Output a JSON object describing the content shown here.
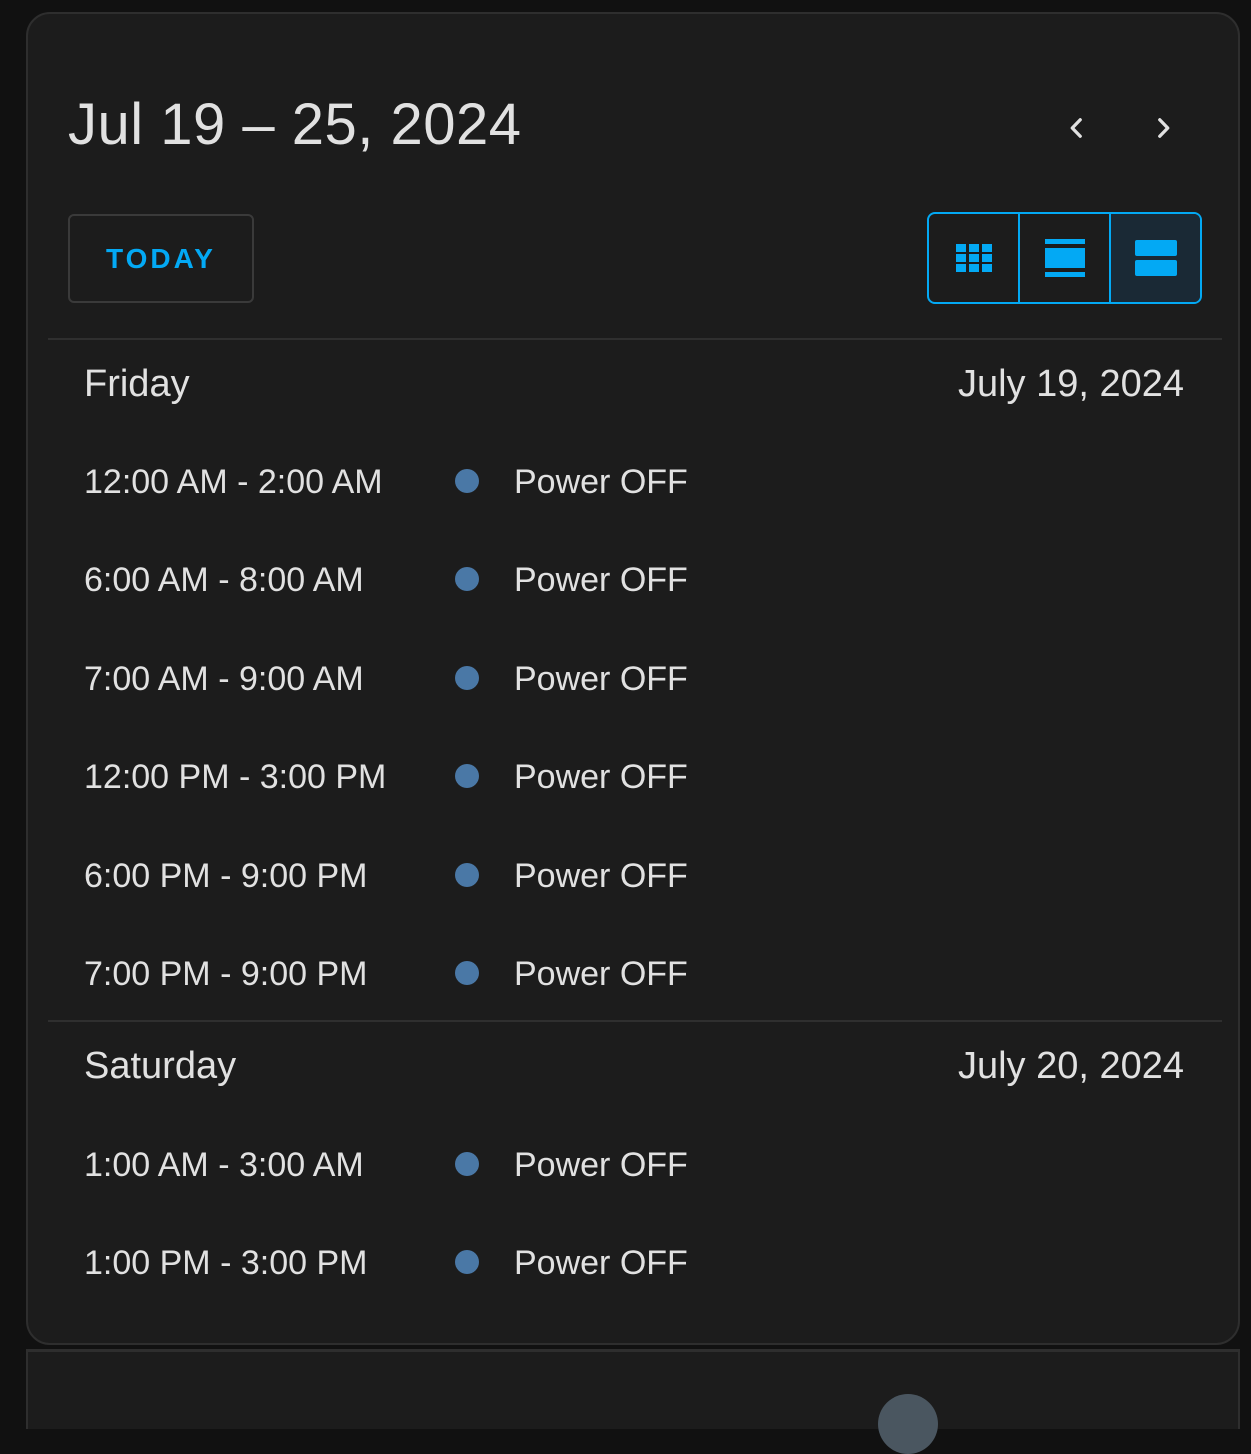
{
  "header": {
    "range_title": "Jul 19 – 25, 2024",
    "prev_icon": "chevron-left-icon",
    "next_icon": "chevron-right-icon"
  },
  "toolbar": {
    "today_label": "TODAY",
    "views": [
      {
        "icon": "month-grid-icon",
        "active": false
      },
      {
        "icon": "week-list-icon",
        "active": false
      },
      {
        "icon": "day-list-icon",
        "active": true
      }
    ]
  },
  "colors": {
    "accent": "#03a9f4",
    "event_dot": "#4a78a6",
    "card_bg": "#1c1c1c",
    "text": "#e1e1e1"
  },
  "days": [
    {
      "name": "Friday",
      "date": "July 19, 2024",
      "events": [
        {
          "time": "12:00 AM - 2:00 AM",
          "title": "Power OFF"
        },
        {
          "time": "6:00 AM - 8:00 AM",
          "title": "Power OFF"
        },
        {
          "time": "7:00 AM - 9:00 AM",
          "title": "Power OFF"
        },
        {
          "time": "12:00 PM - 3:00 PM",
          "title": "Power OFF"
        },
        {
          "time": "6:00 PM - 9:00 PM",
          "title": "Power OFF"
        },
        {
          "time": "7:00 PM - 9:00 PM",
          "title": "Power OFF"
        }
      ]
    },
    {
      "name": "Saturday",
      "date": "July 20, 2024",
      "events": [
        {
          "time": "1:00 AM - 3:00 AM",
          "title": "Power OFF"
        },
        {
          "time": "1:00 PM - 3:00 PM",
          "title": "Power OFF"
        }
      ]
    }
  ]
}
